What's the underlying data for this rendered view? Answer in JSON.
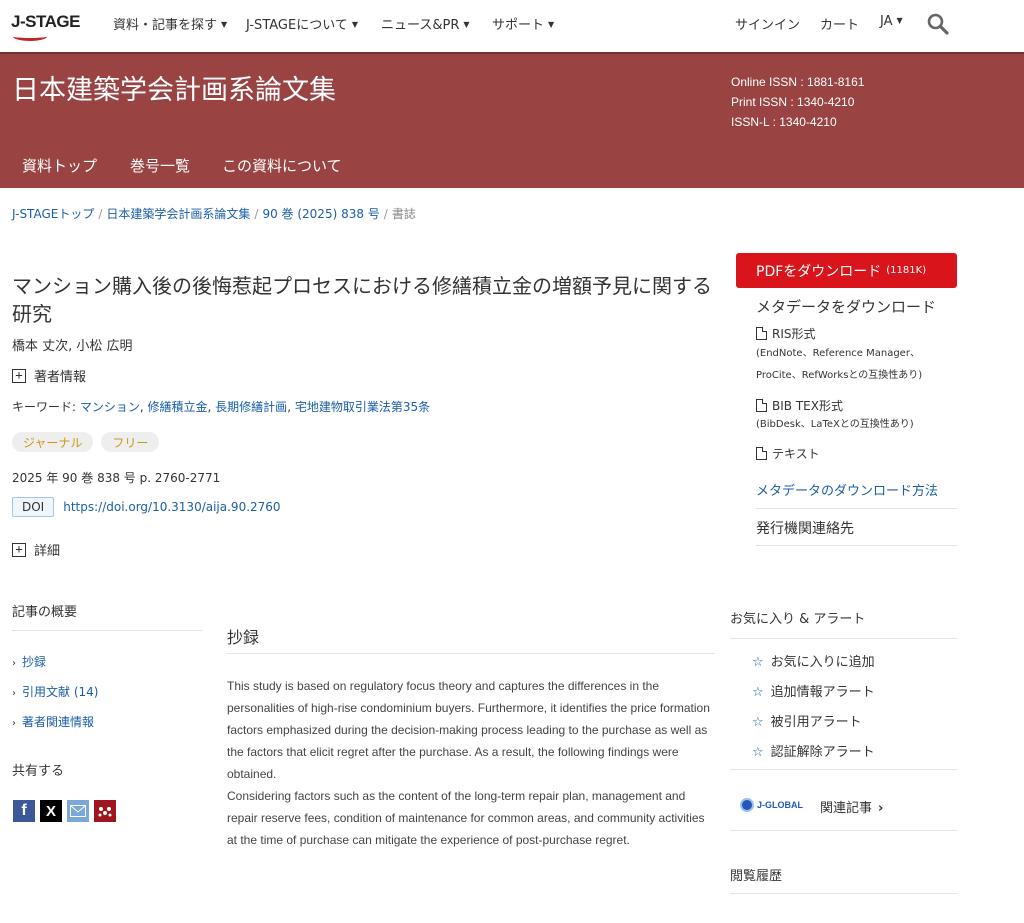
{
  "nav": {
    "logo": "J-STAGE",
    "search_articles": "資料・記事を探す",
    "about": "J-STAGEについて",
    "news": "ニュース&PR",
    "support": "サポート",
    "signin": "サインイン",
    "cart": "カート",
    "lang": "JA"
  },
  "journal": {
    "title": "日本建築学会計画系論文集",
    "online_issn": "Online ISSN : 1881-8161",
    "print_issn": "Print ISSN : 1340-4210",
    "issn_l": "ISSN-L : 1340-4210",
    "tabs": [
      "資料トップ",
      "巻号一覧",
      "この資料について"
    ]
  },
  "breadcrumb": {
    "top": "J-STAGEトップ",
    "journal": "日本建築学会計画系論文集",
    "issue": "90 巻 (2025) 838 号",
    "current": "書誌"
  },
  "article": {
    "title": "マンション購入後の後悔惹起プロセスにおける修繕積立金の増額予見に関する研究",
    "authors": "橋本 丈次, 小松 広明",
    "author_info": "著者情報",
    "keywords_label": "キーワード: ",
    "keywords": [
      "マンション",
      "修繕積立金",
      "長期修繕計画",
      "宅地建物取引業法第35条"
    ],
    "badges": [
      "ジャーナル",
      "フリー"
    ],
    "citation": "2025 年 90 巻 838 号 p. 2760-2771",
    "doi_label": "DOI",
    "doi_url": "https://doi.org/10.3130/aija.90.2760",
    "details": "詳細"
  },
  "left_sidebar": {
    "overview_heading": "記事の概要",
    "links": [
      "抄録",
      "引用文献 (14)",
      "著者関連情報"
    ],
    "share_heading": "共有する"
  },
  "abstract": {
    "heading": "抄録",
    "paragraph1": "This study is based on regulatory focus theory and captures the differences in the personalities of high-rise condominium buyers. Furthermore, it identifies the price formation factors emphasized during the decision-making process leading to the purchase as well as the factors that elicit regret after the purchase. As a result, the following findings were obtained.",
    "paragraph2": "Considering factors such as the content of the long-term repair plan, management and repair reserve fees, condition of maintenance for common areas, and community activities at the time of purchase can mitigate the experience of post-purchase regret."
  },
  "right_sidebar": {
    "pdf_label": "PDFをダウンロード",
    "pdf_size": "(1181K)",
    "meta_heading": "メタデータをダウンロード",
    "ris": "RIS形式",
    "ris_note1": "(EndNote、Reference Manager、",
    "ris_note2": "ProCite、RefWorksとの互換性あり)",
    "bib": "BIB TEX形式",
    "bib_note": "(BibDesk、LaTeXとの互換性あり)",
    "text": "テキスト",
    "howto": "メタデータのダウンロード方法",
    "publisher_contact": "発行機関連絡先",
    "fav_heading": "お気に入り & アラート",
    "alerts": [
      "お気に入りに追加",
      "追加情報アラート",
      "被引用アラート",
      "認証解除アラート"
    ],
    "jglobal_logo": "J-GLOBAL",
    "related": "関連記事",
    "history": "閲覧履歴"
  },
  "colors": {
    "banner": "#9a4343",
    "pdf_button": "#d9141b",
    "link": "#1a5ea8",
    "badge_text": "#c79a16"
  },
  "icons": [
    "search-icon",
    "plus-box-icon",
    "doc-icon",
    "star-icon",
    "chevron-right-icon",
    "facebook-icon",
    "x-icon",
    "mail-icon",
    "mendeley-icon"
  ]
}
